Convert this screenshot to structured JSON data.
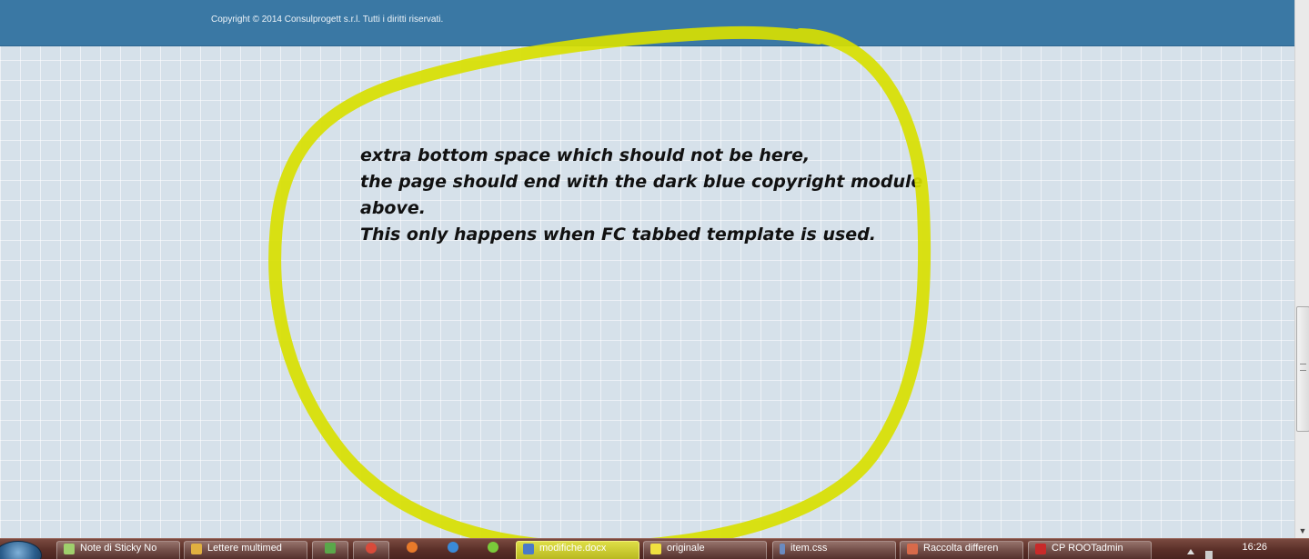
{
  "footer": {
    "copyright": "Copyright © 2014 Consulprogett s.r.l. Tutti i diritti riservati."
  },
  "annotation": {
    "lines": [
      "extra bottom space which should not be here,",
      "the page should end with the dark blue copyright module",
      "above.",
      "This only happens when FC tabbed template is used."
    ],
    "highlight_color": "#d6e000"
  },
  "colors": {
    "footer_bg": "#3a78a4",
    "page_bg": "#d6e1ea",
    "taskbar_bg": "#5a2f28"
  },
  "taskbar": {
    "items": [
      {
        "label": "Note di Sticky No",
        "icon": "sticky-notes-icon"
      },
      {
        "label": "Lettere multimed",
        "icon": "folder-icon"
      },
      {
        "label": "",
        "icon": "app-icon"
      },
      {
        "label": "",
        "icon": "chrome-icon"
      },
      {
        "label": "",
        "icon": "firefox-icon"
      },
      {
        "label": "",
        "icon": "browser-icon"
      },
      {
        "label": "",
        "icon": "app-icon"
      },
      {
        "label": "modifiche.docx",
        "icon": "word-doc-icon"
      },
      {
        "label": "originale",
        "icon": "note-icon"
      },
      {
        "label": "item.css",
        "icon": "file-icon"
      },
      {
        "label": "Raccolta differen",
        "icon": "folder-icon"
      },
      {
        "label": "CP ROOTadmin",
        "icon": "filezilla-icon"
      }
    ],
    "clock": "16:26"
  }
}
